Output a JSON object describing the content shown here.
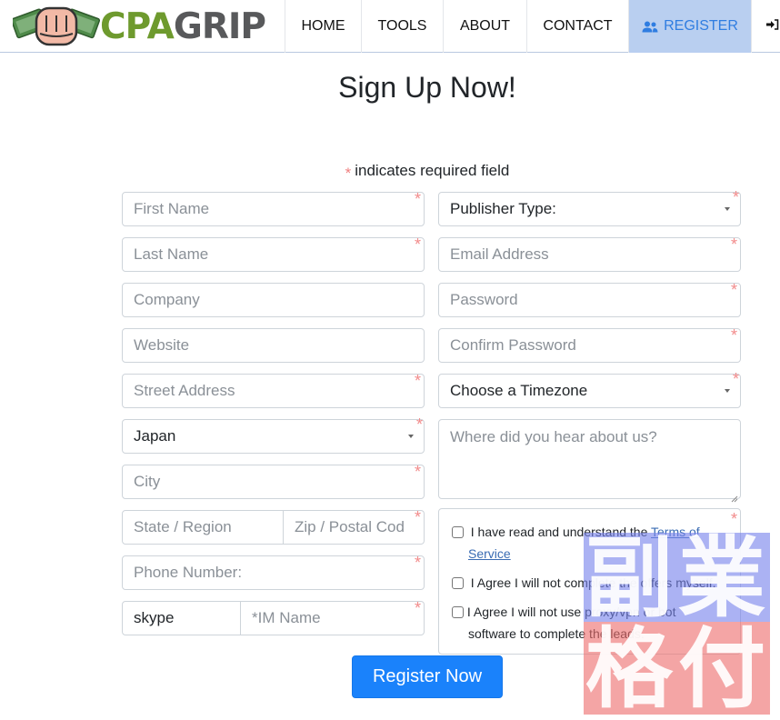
{
  "brand": {
    "name_part1": "CPA",
    "name_part2": "GRIP"
  },
  "nav": {
    "items": [
      {
        "label": "HOME"
      },
      {
        "label": "TOOLS"
      },
      {
        "label": "ABOUT"
      },
      {
        "label": "CONTACT"
      },
      {
        "label": "REGISTER",
        "icon": "users-icon",
        "active": true
      },
      {
        "label": "",
        "icon": "sign-in-icon"
      }
    ]
  },
  "page": {
    "title": "Sign Up Now!",
    "required_note_star": "*",
    "required_note": "indicates required field"
  },
  "form": {
    "left": {
      "first_name": {
        "placeholder": "First Name",
        "required": true
      },
      "last_name": {
        "placeholder": "Last Name",
        "required": true
      },
      "company": {
        "placeholder": "Company",
        "required": false
      },
      "website": {
        "placeholder": "Website",
        "required": false
      },
      "street": {
        "placeholder": "Street Address",
        "required": true
      },
      "country": {
        "value": "Japan",
        "required": true
      },
      "city": {
        "placeholder": "City",
        "required": true
      },
      "state": {
        "placeholder": "State / Region"
      },
      "zip": {
        "placeholder": "Zip / Postal Cod",
        "required": true
      },
      "phone": {
        "placeholder": "Phone Number:",
        "required": true
      },
      "im_type": {
        "value": "skype"
      },
      "im_name": {
        "placeholder": "*IM Name",
        "required": true
      }
    },
    "right": {
      "publisher_type": {
        "value": "Publisher Type:",
        "required": true
      },
      "email": {
        "placeholder": "Email Address",
        "required": true
      },
      "password": {
        "placeholder": "Password",
        "required": true
      },
      "confirm_password": {
        "placeholder": "Confirm Password",
        "required": true
      },
      "timezone": {
        "value": "Choose a Timezone",
        "required": true
      },
      "referral": {
        "placeholder": "Where did you hear about us?"
      }
    },
    "agreements": {
      "tos_prefix": "I have read and understand the",
      "tos_link": "Terms of Service",
      "tos_link_1": "Terms of",
      "tos_link_2": "Service",
      "no_self_offers": "I Agree I will not complete the offers myself.",
      "no_proxy_1": "I Agree I will not use proxy/vpn or bot",
      "no_proxy_2": "software to complete the leads."
    },
    "submit_label": "Register Now",
    "required_star": "*"
  },
  "watermark": {
    "chars": [
      "副",
      "業",
      "格",
      "付"
    ]
  },
  "colors": {
    "accent": "#1a82fb",
    "nav_active_bg": "#b9cff0",
    "nav_active_text": "#2f7de1",
    "required_star": "#f28b8b",
    "brand_green": "#6e9a2e",
    "brand_gray": "#58595b"
  }
}
